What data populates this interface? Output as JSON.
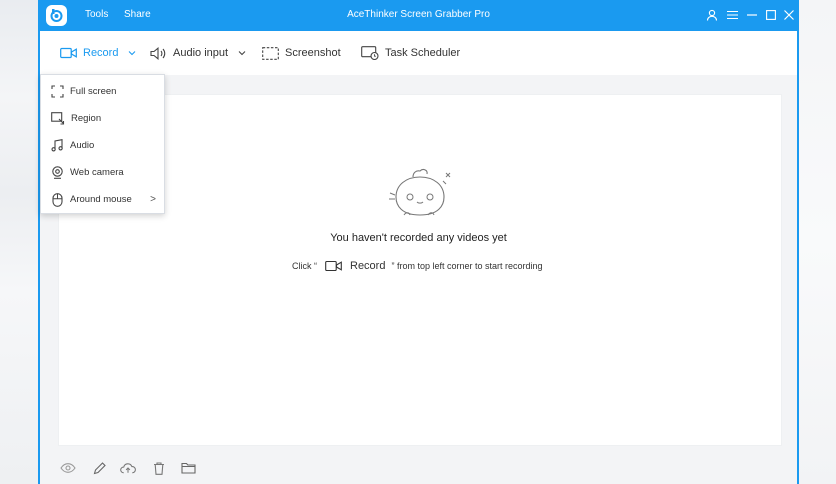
{
  "window": {
    "title": "AceThinker Screen Grabber Pro",
    "menu": {
      "tools": "Tools",
      "share": "Share"
    },
    "accent_color": "#1a9af0"
  },
  "toolbar": {
    "record": "Record",
    "audio_input": "Audio input",
    "screenshot": "Screenshot",
    "task_scheduler": "Task Scheduler"
  },
  "record_menu": {
    "items": [
      {
        "label": "Full screen",
        "icon": "fullscreen-icon"
      },
      {
        "label": "Region",
        "icon": "region-icon"
      },
      {
        "label": "Audio",
        "icon": "music-note-icon"
      },
      {
        "label": "Web camera",
        "icon": "webcam-icon"
      },
      {
        "label": "Around mouse",
        "icon": "mouse-icon",
        "submenu": ">"
      }
    ]
  },
  "empty_state": {
    "title": "You haven't recorded any videos yet",
    "hint_prefix": "Click “",
    "hint_record": "Record",
    "hint_suffix": "” from top left corner to start recording"
  },
  "bottom_bar": {
    "icons": [
      "eye-icon",
      "pencil-icon",
      "cloud-upload-icon",
      "trash-icon",
      "folder-icon"
    ]
  }
}
